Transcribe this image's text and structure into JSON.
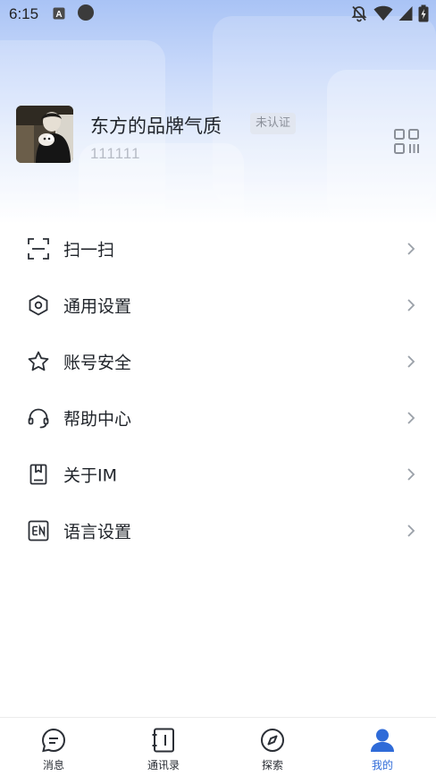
{
  "status_bar": {
    "time": "6:15",
    "icons": [
      "app-a-icon",
      "record-dot-icon",
      "bell-off-icon",
      "wifi-icon",
      "signal-icon",
      "battery-charging-icon"
    ]
  },
  "profile": {
    "name": "东方的品牌气质",
    "badge": "未认证",
    "user_id": "111111",
    "qr_icon": "qr-code-icon"
  },
  "menu": {
    "items": [
      {
        "label": "扫一扫",
        "icon": "scan-icon"
      },
      {
        "label": "通用设置",
        "icon": "hex-settings-icon"
      },
      {
        "label": "账号安全",
        "icon": "star-icon"
      },
      {
        "label": "帮助中心",
        "icon": "headset-icon"
      },
      {
        "label": "关于IM",
        "icon": "book-icon"
      },
      {
        "label": "语言设置",
        "icon": "en-language-icon"
      }
    ]
  },
  "tabbar": {
    "tabs": [
      {
        "label": "消息",
        "icon": "message-icon",
        "active": false
      },
      {
        "label": "通讯录",
        "icon": "contacts-icon",
        "active": false
      },
      {
        "label": "探索",
        "icon": "compass-icon",
        "active": false
      },
      {
        "label": "我的",
        "icon": "user-icon",
        "active": true
      }
    ]
  },
  "colors": {
    "accent": "#2f6bd8",
    "text_primary": "#1f2329",
    "text_muted": "#b7bcc6",
    "header_gradient_top": "#a9c3f5"
  }
}
